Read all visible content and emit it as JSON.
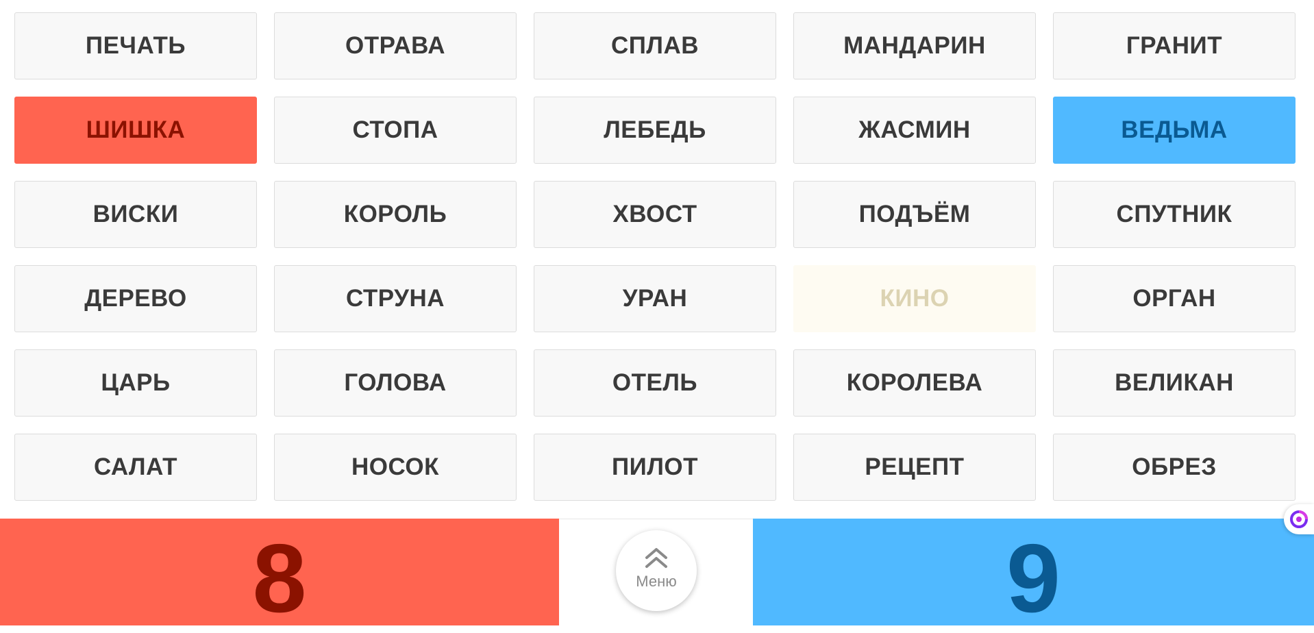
{
  "cards": [
    {
      "word": "ПЕЧАТЬ",
      "state": "hidden"
    },
    {
      "word": "ОТРАВА",
      "state": "hidden"
    },
    {
      "word": "СПЛАВ",
      "state": "hidden"
    },
    {
      "word": "МАНДАРИН",
      "state": "hidden"
    },
    {
      "word": "ГРАНИТ",
      "state": "hidden"
    },
    {
      "word": "ШИШКА",
      "state": "red"
    },
    {
      "word": "СТОПА",
      "state": "hidden"
    },
    {
      "word": "ЛЕБЕДЬ",
      "state": "hidden"
    },
    {
      "word": "ЖАСМИН",
      "state": "hidden"
    },
    {
      "word": "ВЕДЬМА",
      "state": "blue"
    },
    {
      "word": "ВИСКИ",
      "state": "hidden"
    },
    {
      "word": "КОРОЛЬ",
      "state": "hidden"
    },
    {
      "word": "ХВОСТ",
      "state": "hidden"
    },
    {
      "word": "ПОДЪЁМ",
      "state": "hidden"
    },
    {
      "word": "СПУТНИК",
      "state": "hidden"
    },
    {
      "word": "ДЕРЕВО",
      "state": "hidden"
    },
    {
      "word": "СТРУНА",
      "state": "hidden"
    },
    {
      "word": "УРАН",
      "state": "hidden"
    },
    {
      "word": "КИНО",
      "state": "neutral"
    },
    {
      "word": "ОРГАН",
      "state": "hidden"
    },
    {
      "word": "ЦАРЬ",
      "state": "hidden"
    },
    {
      "word": "ГОЛОВА",
      "state": "hidden"
    },
    {
      "word": "ОТЕЛЬ",
      "state": "hidden"
    },
    {
      "word": "КОРОЛЕВА",
      "state": "hidden"
    },
    {
      "word": "ВЕЛИКАН",
      "state": "hidden"
    },
    {
      "word": "САЛАТ",
      "state": "hidden"
    },
    {
      "word": "НОСОК",
      "state": "hidden"
    },
    {
      "word": "ПИЛОТ",
      "state": "hidden"
    },
    {
      "word": "РЕЦЕПТ",
      "state": "hidden"
    },
    {
      "word": "ОБРЕЗ",
      "state": "hidden"
    }
  ],
  "scores": {
    "red": "8",
    "blue": "9"
  },
  "menu": {
    "label": "Меню",
    "icon": "double-chevron-up-icon"
  },
  "edge_widget": {
    "icon": "assistant-logo-icon"
  },
  "colors": {
    "red_team": "#ff6450",
    "red_text": "#8b1200",
    "blue_team": "#50b9ff",
    "blue_text": "#0a5a92",
    "neutral_card": "#fefbf2",
    "neutral_text": "#dcd3b2",
    "hidden_card": "#f8f8f8",
    "hidden_text": "#3a3a3a"
  }
}
